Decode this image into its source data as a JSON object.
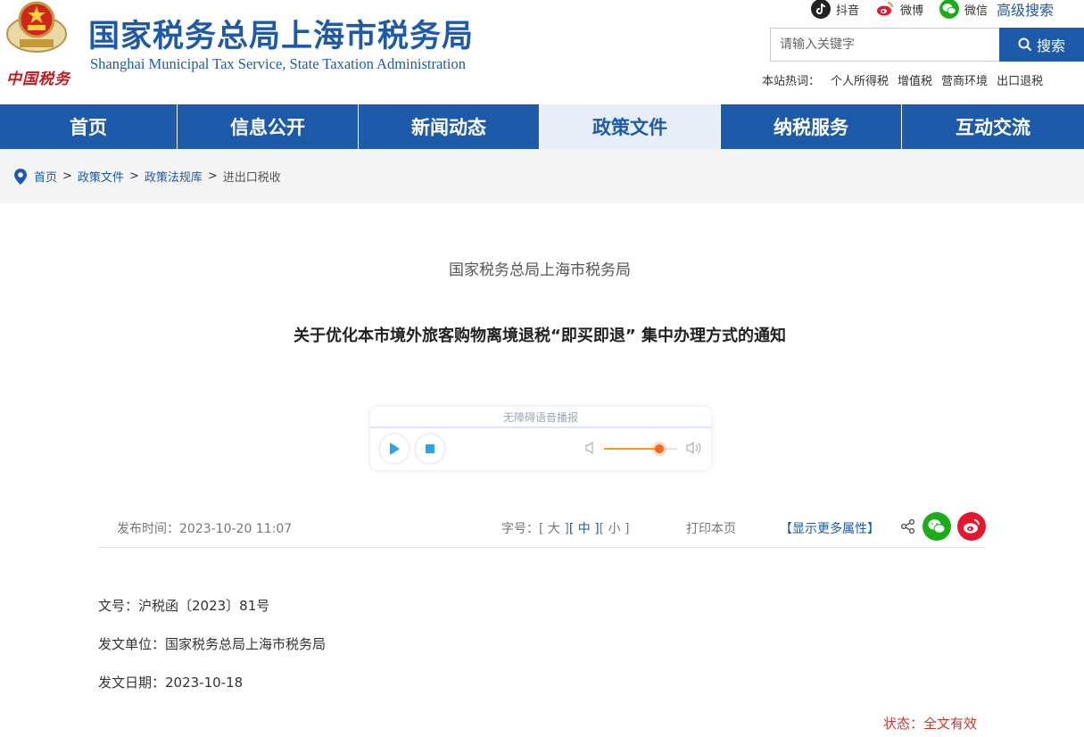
{
  "header": {
    "brand_script": "中国税务",
    "site_title": "国家税务总局上海市税务局",
    "site_subtitle": "Shanghai Municipal Tax Service, State Taxation Administration",
    "social": [
      {
        "icon": "douyin-icon",
        "label": "抖音"
      },
      {
        "icon": "weibo-icon",
        "label": "微博"
      },
      {
        "icon": "wechat-icon",
        "label": "微信"
      }
    ],
    "advanced_search": "高级搜索",
    "search": {
      "placeholder": "请输入关键字",
      "button_label": "搜索"
    },
    "hotwords_label": "本站热词：",
    "hotwords": [
      "个人所得税",
      "增值税",
      "营商环境",
      "出口退税"
    ]
  },
  "nav": {
    "items": [
      "首页",
      "信息公开",
      "新闻动态",
      "政策文件",
      "纳税服务",
      "互动交流"
    ],
    "active_index": 3
  },
  "breadcrumb": {
    "items": [
      "首页",
      "政策文件",
      "政策法规库"
    ],
    "separator": ">",
    "current": "进出口税收"
  },
  "article": {
    "source_org": "国家税务总局上海市税务局",
    "title": "关于优化本市境外旅客购物离境退税“即买即退” 集中办理方式的通知",
    "audio": {
      "label": "无障碍语音播报",
      "volume": 0.75
    },
    "meta": {
      "publish_time": "发布时间：2023-10-20 11:07",
      "font_label": "字号：",
      "font_sizes": [
        "[ 大 ]",
        "[ 中 ]",
        "[ 小 ]"
      ],
      "font_active_index": 1,
      "print": "打印本页",
      "more_attrs": "【显示更多属性】"
    },
    "doc_number": "文号：沪税函〔2023〕81号",
    "issuer": "发文单位：国家税务总局上海市税务局",
    "issue_date": "发文日期：2023-10-18",
    "status": "状态：全文有效"
  },
  "colors": {
    "brand_blue": "#1d5aaa",
    "nav_active_bg": "#e8eef7",
    "status_red": "#c43a2e"
  }
}
